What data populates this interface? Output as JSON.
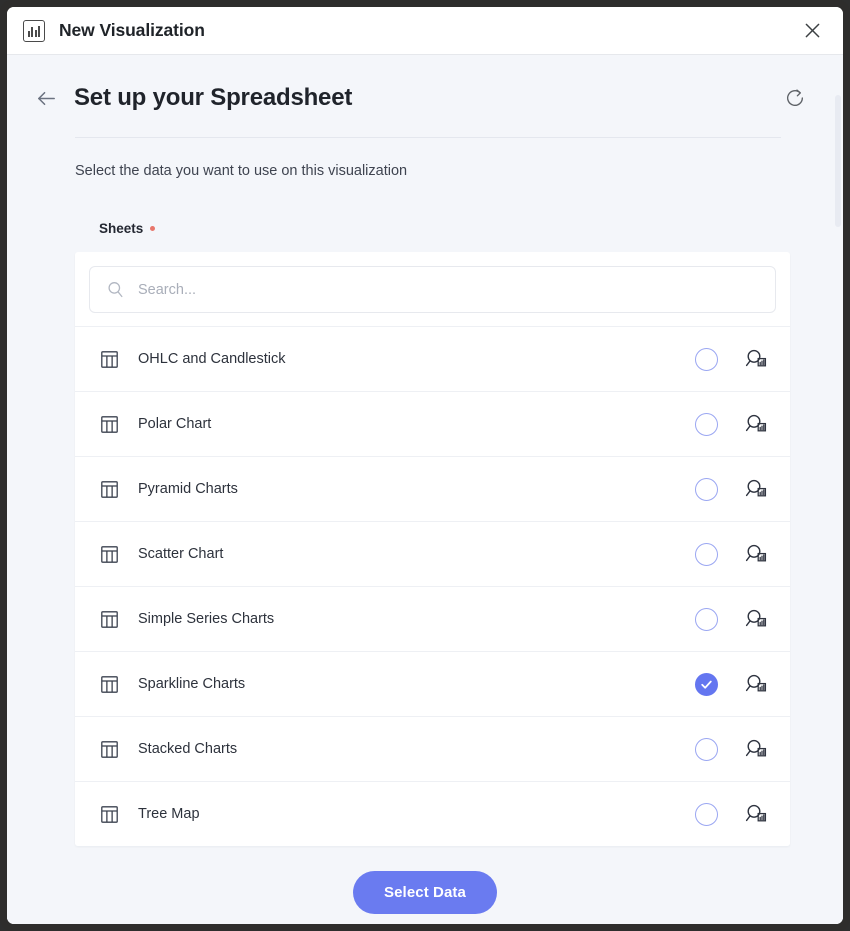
{
  "window": {
    "title": "New Visualization",
    "app_icon": "bar-chart-icon",
    "close_icon": "close-icon"
  },
  "page": {
    "back_icon": "arrow-left-icon",
    "title": "Set up your Spreadsheet",
    "refresh_icon": "refresh-icon",
    "subtitle": "Select the data you want to use on this visualization",
    "field_label": "Sheets",
    "required_marker": "required-dot"
  },
  "search": {
    "placeholder": "Search...",
    "value": "",
    "icon": "search-icon"
  },
  "sheets": [
    {
      "label": "OHLC and Candlestick",
      "selected": false,
      "icon": "table-icon",
      "preview_icon": "search-data-icon"
    },
    {
      "label": "Polar Chart",
      "selected": false,
      "icon": "table-icon",
      "preview_icon": "search-data-icon"
    },
    {
      "label": "Pyramid Charts",
      "selected": false,
      "icon": "table-icon",
      "preview_icon": "search-data-icon"
    },
    {
      "label": "Scatter Chart",
      "selected": false,
      "icon": "table-icon",
      "preview_icon": "search-data-icon"
    },
    {
      "label": "Simple Series Charts",
      "selected": false,
      "icon": "table-icon",
      "preview_icon": "search-data-icon"
    },
    {
      "label": "Sparkline Charts",
      "selected": true,
      "icon": "table-icon",
      "preview_icon": "search-data-icon"
    },
    {
      "label": "Stacked Charts",
      "selected": false,
      "icon": "table-icon",
      "preview_icon": "search-data-icon"
    },
    {
      "label": "Tree Map",
      "selected": false,
      "icon": "table-icon",
      "preview_icon": "search-data-icon"
    }
  ],
  "footer": {
    "primary_button": "Select Data"
  },
  "colors": {
    "accent": "#6a7bf0",
    "required": "#e8766b",
    "page_bg": "#f4f6fa",
    "card_bg": "#ffffff",
    "frame": "#2e2d2c"
  }
}
